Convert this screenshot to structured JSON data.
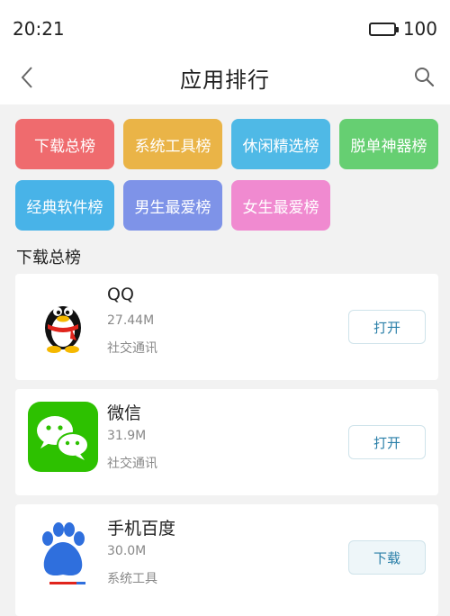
{
  "status": {
    "time": "20:21",
    "battery": "100"
  },
  "nav": {
    "title": "应用排行",
    "back_icon": "chevron-left-icon",
    "search_icon": "search-icon"
  },
  "categories": [
    {
      "label": "下载总榜",
      "color": "#ef6b6e"
    },
    {
      "label": "系统工具榜",
      "color": "#eab447"
    },
    {
      "label": "休闲精选榜",
      "color": "#4fb9e6"
    },
    {
      "label": "脱单神器榜",
      "color": "#66cf72"
    },
    {
      "label": "经典软件榜",
      "color": "#48b3e8"
    },
    {
      "label": "男生最爱榜",
      "color": "#7e93e8"
    },
    {
      "label": "女生最爱榜",
      "color": "#f08ad0"
    }
  ],
  "section": {
    "title": "下载总榜"
  },
  "apps": [
    {
      "name": "QQ",
      "size": "27.44M",
      "category": "社交通讯",
      "action": "打开",
      "icon": "qq-penguin-icon"
    },
    {
      "name": "微信",
      "size": "31.9M",
      "category": "社交通讯",
      "action": "打开",
      "icon": "wechat-icon"
    },
    {
      "name": "手机百度",
      "size": "30.0M",
      "category": "系统工具",
      "action": "下载",
      "icon": "baidu-paw-icon"
    }
  ],
  "colors": {
    "accent_text": "#2a7fa8",
    "button_border": "#cfe3ea",
    "wechat_green": "#2dc100",
    "baidu_blue": "#2f6fdd"
  }
}
